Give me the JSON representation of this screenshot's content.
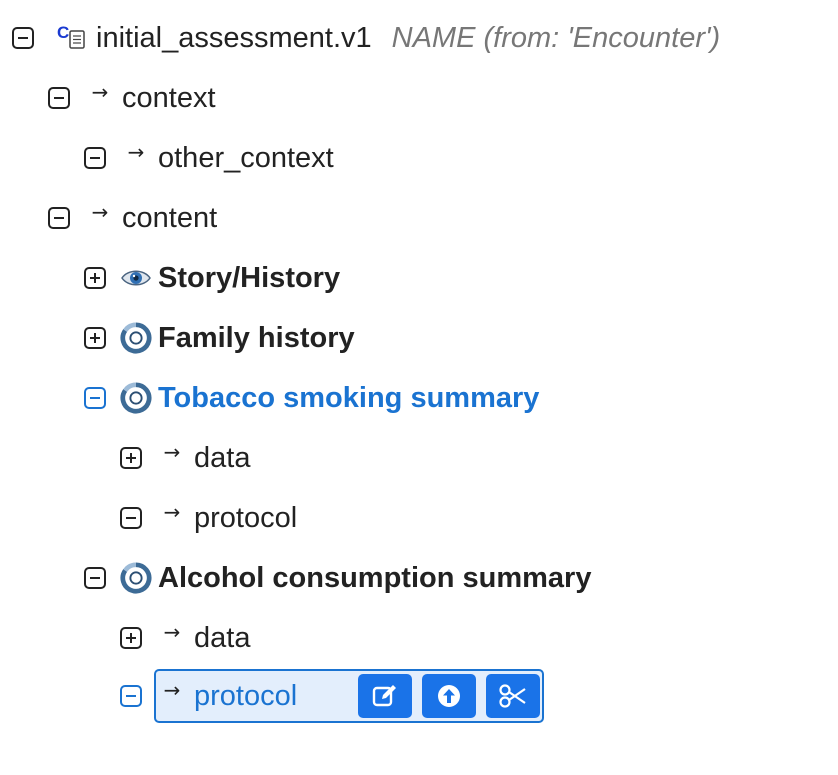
{
  "root": {
    "label": "initial_assessment.v1",
    "annotation": "NAME (from: 'Encounter')",
    "toggle": "collapse"
  },
  "nodes": [
    {
      "label": "context",
      "toggle": "collapse",
      "icon": "arrow-icon"
    },
    {
      "label": "other_context",
      "toggle": "collapse",
      "icon": "arrow-icon"
    },
    {
      "label": "content",
      "toggle": "collapse",
      "icon": "arrow-icon"
    },
    {
      "label": "Story/History",
      "toggle": "expand",
      "icon": "eye-icon"
    },
    {
      "label": "Family history",
      "toggle": "expand",
      "icon": "archetype-icon"
    },
    {
      "label": "Tobacco smoking summary",
      "toggle": "collapse",
      "icon": "archetype-icon",
      "active": true
    },
    {
      "label": "data",
      "toggle": "expand",
      "icon": "arrow-icon"
    },
    {
      "label": "protocol",
      "toggle": "collapse",
      "icon": "arrow-icon"
    },
    {
      "label": "Alcohol consumption summary",
      "toggle": "collapse",
      "icon": "archetype-icon"
    },
    {
      "label": "data",
      "toggle": "expand",
      "icon": "arrow-icon"
    },
    {
      "label": "protocol",
      "toggle": "collapse",
      "icon": "arrow-icon",
      "selected": true
    }
  ],
  "icons": {
    "arrow": "→"
  },
  "actions": [
    {
      "name": "edit-icon"
    },
    {
      "name": "upload-icon"
    },
    {
      "name": "scissors-icon"
    }
  ],
  "colors": {
    "accent": "#1a73e8",
    "selected_bg": "#e3eefc",
    "text": "#222222",
    "muted": "#777777"
  }
}
